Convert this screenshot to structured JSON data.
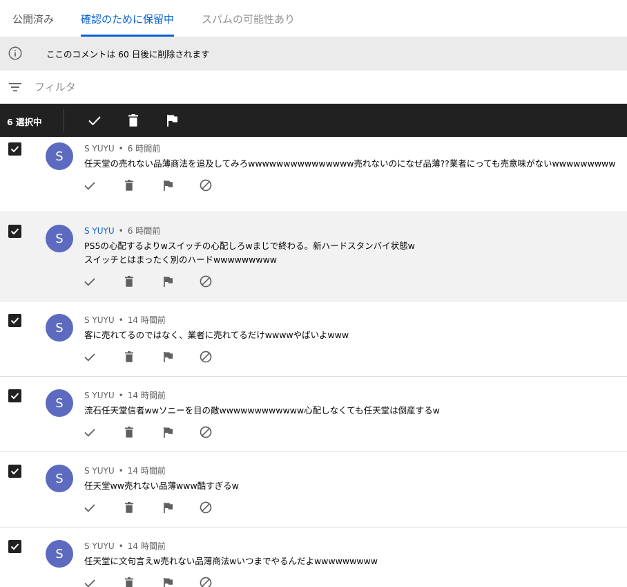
{
  "tabs": [
    {
      "label": "公開済み",
      "active": false
    },
    {
      "label": "確認のために保留中",
      "active": true
    },
    {
      "label": "スパムの可能性あり",
      "active": false
    }
  ],
  "banner": {
    "icon": "info-icon",
    "text": "ここのコメントは 60 日後に削除されます"
  },
  "filter": {
    "icon": "filter-icon",
    "placeholder": "フィルタ"
  },
  "selection_bar": {
    "count_label": "6 選択中",
    "actions": [
      "approve-icon",
      "delete-icon",
      "flag-icon"
    ]
  },
  "comments": [
    {
      "avatar": "S",
      "author": "S YUYU",
      "author_highlight": false,
      "time": "6 時間前",
      "lines": [
        "任天堂の売れない品薄商法を追及してみろwwwwwwwwwwwwwww売れないのになぜ品薄??業者にっても売意味がないwwwwwwwww"
      ],
      "checked": true,
      "highlighted": false
    },
    {
      "avatar": "S",
      "author": "S YUYU",
      "author_highlight": true,
      "time": "6 時間前",
      "lines": [
        "PS5の心配するよりwスイッチの心配しろwまじで終わる。新ハードスタンバイ状態w",
        "スイッチとはまったく別のハードwwwwwwwww"
      ],
      "checked": true,
      "highlighted": true
    },
    {
      "avatar": "S",
      "author": "S YUYU",
      "author_highlight": false,
      "time": "14 時間前",
      "lines": [
        "客に売れてるのではなく、業者に売れてるだけwwwwやばいよwww"
      ],
      "checked": true,
      "highlighted": false
    },
    {
      "avatar": "S",
      "author": "S YUYU",
      "author_highlight": false,
      "time": "14 時間前",
      "lines": [
        "流石任天堂信者wwソニーを目の敵wwwwwwwwwwww心配しなくても任天堂は倒産するw"
      ],
      "checked": true,
      "highlighted": false
    },
    {
      "avatar": "S",
      "author": "S YUYU",
      "author_highlight": false,
      "time": "14 時間前",
      "lines": [
        "任天堂ww売れない品薄www酷すぎるw"
      ],
      "checked": true,
      "highlighted": false
    },
    {
      "avatar": "S",
      "author": "S YUYU",
      "author_highlight": false,
      "time": "14 時間前",
      "lines": [
        "任天堂に文句言えw売れない品薄商法wいつまでやるんだよwwwwwwwww"
      ],
      "checked": true,
      "highlighted": false
    }
  ],
  "row_actions": [
    "approve-icon",
    "delete-icon",
    "flag-icon",
    "block-icon"
  ],
  "colors": {
    "accent": "#065fd4",
    "avatar": "#5c6bc0",
    "selection_bar": "#212121",
    "banner": "#ebebeb",
    "highlight_row": "#f2f2f2"
  }
}
